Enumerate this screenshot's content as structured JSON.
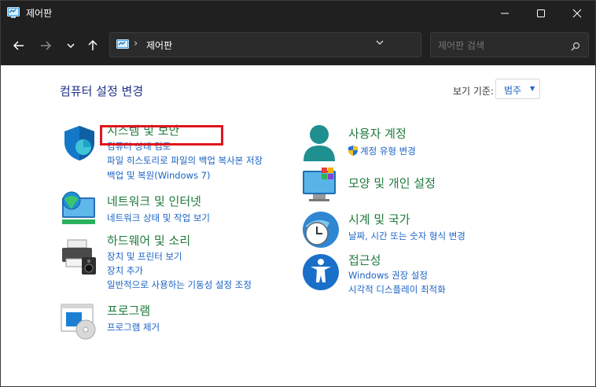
{
  "window": {
    "title": "제어판",
    "minimize_icon": "minimize-icon",
    "maximize_icon": "maximize-icon",
    "close_icon": "close-icon"
  },
  "nav": {
    "back_icon": "back-arrow-icon",
    "forward_icon": "forward-arrow-icon",
    "recent_icon": "chevron-down-icon",
    "up_icon": "up-arrow-icon"
  },
  "address": {
    "path": "제어판",
    "separator": "›"
  },
  "search": {
    "placeholder": "제어판 검색"
  },
  "main": {
    "heading": "컴퓨터 설정 변경",
    "view_by_label": "보기 기준:",
    "view_by_value": "범주"
  },
  "categories_left": [
    {
      "title": "시스템 및 보안",
      "icon": "shield-icon",
      "links": [
        "컴퓨터 상태 검토",
        "파일 히스토리로 파일의 백업 복사본 저장",
        "백업 및 복원(Windows 7)"
      ]
    },
    {
      "title": "네트워크 및 인터넷",
      "icon": "network-globe-icon",
      "links": [
        "네트워크 상태 및 작업 보기"
      ]
    },
    {
      "title": "하드웨어 및 소리",
      "icon": "printer-speaker-icon",
      "links": [
        "장치 및 프린터 보기",
        "장치 추가",
        "일반적으로 사용하는 기동성 설정 조정"
      ]
    },
    {
      "title": "프로그램",
      "icon": "programs-disc-icon",
      "links": [
        "프로그램 제거"
      ]
    }
  ],
  "categories_right": [
    {
      "title": "사용자 계정",
      "icon": "user-icon",
      "links": [
        "계정 유형 변경"
      ]
    },
    {
      "title": "모양 및 개인 설정",
      "icon": "monitor-palette-icon",
      "links": []
    },
    {
      "title": "시계 및 국가",
      "icon": "clock-globe-icon",
      "links": [
        "날짜, 시간 또는 숫자 형식 변경"
      ]
    },
    {
      "title": "접근성",
      "icon": "accessibility-icon",
      "links": [
        "Windows 권장 설정",
        "시각적 디스플레이 최적화"
      ]
    }
  ],
  "colors": {
    "titlebar": "#202020",
    "category_title": "#1f7a3c",
    "link": "#1a62c4",
    "heading": "#1e3287",
    "highlight": "#e0141e"
  }
}
